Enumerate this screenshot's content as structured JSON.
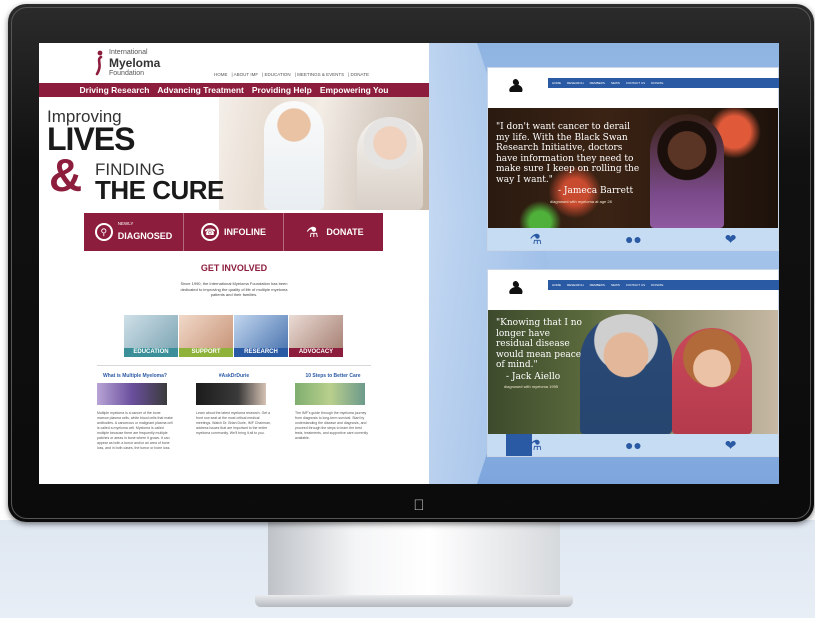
{
  "left_site": {
    "logo": {
      "line1": "International",
      "line2": "Myeloma",
      "line3": "Foundation"
    },
    "top_nav": [
      "HOME",
      "ABOUT IMF",
      "EDUCATION",
      "MEETINGS & EVENTS",
      "DONATE"
    ],
    "main_nav": [
      "Driving Research",
      "Advancing Treatment",
      "Providing Help",
      "Empowering You"
    ],
    "hero": {
      "improving": "Improving",
      "lives": "LIVES",
      "amp": "&",
      "finding": "FINDING",
      "cure": "THE CURE"
    },
    "cta": [
      {
        "small": "NEWLY",
        "label": "DIAGNOSED",
        "icon": "magnifier-icon"
      },
      {
        "small": "",
        "label": "INFOLINE",
        "icon": "phone-icon"
      },
      {
        "small": "",
        "label": "DONATE",
        "icon": "flask-icon"
      }
    ],
    "get_involved": "GET INVOLVED",
    "intro": "Since 1990, the International Myeloma Foundation has been dedicated to improving the quality of life of multiple myeloma patients and their families.",
    "tiles": [
      "EDUCATION",
      "SUPPORT",
      "RESEARCH",
      "ADVOCACY"
    ],
    "columns": [
      {
        "title": "What is Multiple Myeloma?",
        "text": "Multiple myeloma is a cancer of the bone marrow plasma cells, white blood cells that make antibodies. A cancerous or malignant plasma cell is called a myeloma cell. Myeloma is called multiple because there are frequently multiple patches or areas in bone where it grows. It can appear as both a tumor and/or an area of bone loss, and in both cases, the tumor or bone loss."
      },
      {
        "title": "#AskDrDurie",
        "text": "Learn about the latest myeloma research. Get a front row seat at the most critical medical meetings. Watch Dr. Brian Durie, IMF Chairman, address issues that are important to the entire myeloma community. We'll bring it all to you."
      },
      {
        "title": "10 Steps to Better Care",
        "text": "The IMF's guide through the myeloma journey from diagnosis to long-term survival. Start by understanding the disease and diagnosis, and proceed through the steps to learn the best tests, treatments, and supportive care currently available."
      }
    ]
  },
  "shot1": {
    "quote": "\"I don't want cancer to derail my life. With the Black Swan Research Initiative, doctors have information they need to make sure I keep on rolling the way I want.\"",
    "author": "- Jameca Barrett",
    "sub": "diagnosed with myeloma at age 28"
  },
  "shot2": {
    "quote": "\"Knowing that I no longer have residual disease would mean peace of mind.\"",
    "author": "- Jack Aiello",
    "sub": "diagnosed with myeloma 1995"
  },
  "shot_nav": [
    "HOME",
    "RESEARCH",
    "MEMBERS",
    "NEWS",
    "CONTACT US",
    "DONATE"
  ],
  "shot_icons": [
    "flask-icon",
    "people-icon",
    "heart-icon"
  ],
  "colors": {
    "brand_maroon": "#8d1d3c",
    "swan_blue": "#2b5aa5",
    "screen_bg": "#9fc1e8"
  }
}
